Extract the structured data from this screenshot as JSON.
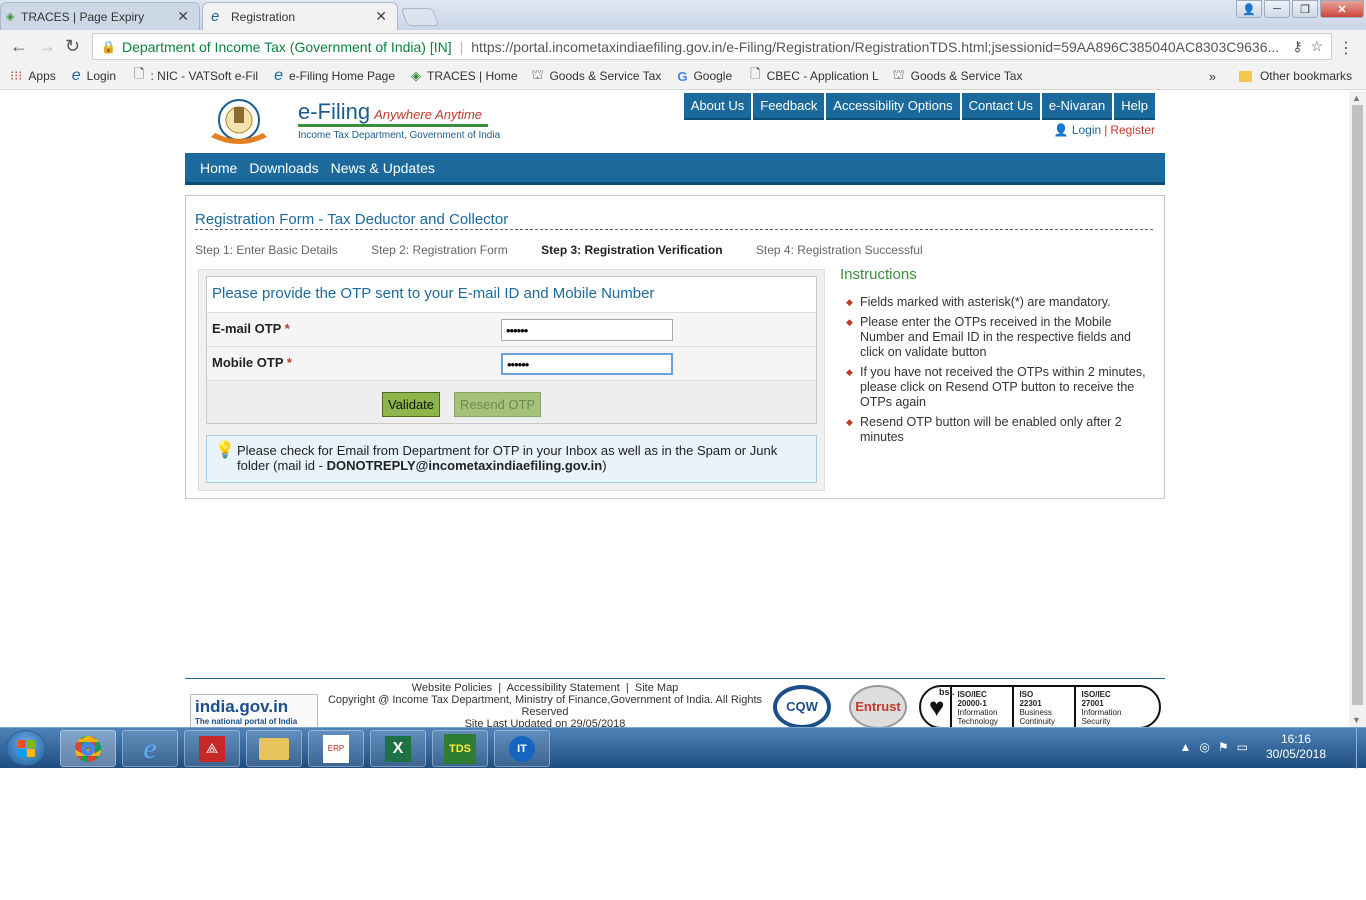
{
  "browser": {
    "tabs": [
      {
        "title": "TRACES | Page Expiry",
        "active": false
      },
      {
        "title": "Registration",
        "active": true
      }
    ],
    "site_identity": "Department of Income Tax (Government of India) [IN]",
    "url": "https://portal.incometaxindiaefiling.gov.in/e-Filing/Registration/RegistrationTDS.html;jsessionid=59AA896C385040AC8303C9636...",
    "bookmarks": [
      {
        "label": "Apps",
        "icon": "apps-grid-icon"
      },
      {
        "label": "Login",
        "icon": "ie-icon"
      },
      {
        "label": ": NIC - VATSoft e-Fil",
        "icon": "page-icon"
      },
      {
        "label": "e-Filing Home Page",
        "icon": "ie-icon"
      },
      {
        "label": "TRACES | Home",
        "icon": "traces-icon"
      },
      {
        "label": "Goods & Service Tax",
        "icon": "emblem-icon"
      },
      {
        "label": "Google",
        "icon": "google-icon"
      },
      {
        "label": "CBEC - Application L",
        "icon": "page-icon"
      },
      {
        "label": "Goods & Service Tax",
        "icon": "emblem-icon"
      }
    ],
    "bookmarks_more": "»",
    "other_bookmarks": "Other bookmarks"
  },
  "site": {
    "logo_title": "e-Filing",
    "logo_tagline": "Anywhere Anytime",
    "logo_sub": "Income Tax Department, Government of India",
    "top_nav": [
      "About Us",
      "Feedback",
      "Accessibility Options",
      "Contact Us",
      "e-Nivaran",
      "Help"
    ],
    "login": "Login",
    "login_sep": "|",
    "register": "Register",
    "main_nav": [
      "Home",
      "Downloads",
      "News & Updates"
    ]
  },
  "form": {
    "title": "Registration Form - Tax Deductor and Collector",
    "steps": [
      {
        "label": "Step 1: Enter Basic Details",
        "current": false
      },
      {
        "label": "Step 2: Registration Form",
        "current": false
      },
      {
        "label": "Step 3: Registration Verification",
        "current": true
      },
      {
        "label": "Step 4: Registration Successful",
        "current": false
      }
    ],
    "panel_heading": "Please provide the OTP sent to your E-mail ID and Mobile Number",
    "email_otp_label": "E-mail OTP",
    "email_otp_value": "••••••",
    "mobile_otp_label": "Mobile OTP",
    "mobile_otp_value": "••••••",
    "required_mark": "*",
    "validate_label": "Validate",
    "resend_label": "Resend OTP",
    "note_text": "Please check for Email from Department for OTP in your Inbox as well as in the Spam or Junk folder (mail id - ",
    "note_email": "DONOTREPLY@incometaxindiaefiling.gov.in",
    "note_close": ")"
  },
  "instructions": {
    "title": "Instructions",
    "items": [
      "Fields marked with asterisk(*) are mandatory.",
      "Please enter the OTPs received in the Mobile Number and Email ID in the respective fields and click on validate button",
      "If you have not received the OTPs within 2 minutes, please click on Resend OTP button to receive the OTPs again",
      "Resend OTP button will be enabled only after 2 minutes"
    ]
  },
  "footer": {
    "links": [
      "Website Policies",
      "Accessibility Statement",
      "Site Map"
    ],
    "link_sep": "|",
    "copyright": "Copyright @ Income Tax Department, Ministry of Finance,Government of India. All Rights Reserved",
    "last_updated": "Site Last Updated on 29/05/2018",
    "india_gov": "india.gov.in",
    "india_gov_sub": "The national portal of India",
    "cqw": "CQW",
    "entrust": "Entrust",
    "bsi": "bsi.",
    "iso": [
      {
        "code": "ISO/IEC",
        "num": "20000-1",
        "desc": "Information Technology Service"
      },
      {
        "code": "ISO",
        "num": "22301",
        "desc": "Business Continuity"
      },
      {
        "code": "ISO/IEC",
        "num": "27001",
        "desc": "Information Security Management"
      }
    ]
  },
  "taskbar": {
    "time": "16:16",
    "date": "30/05/2018",
    "apps": [
      "chrome",
      "internet-explorer",
      "acrobat",
      "file-explorer",
      "tally-erp9",
      "excel",
      "saral-tds",
      "it-app"
    ]
  }
}
